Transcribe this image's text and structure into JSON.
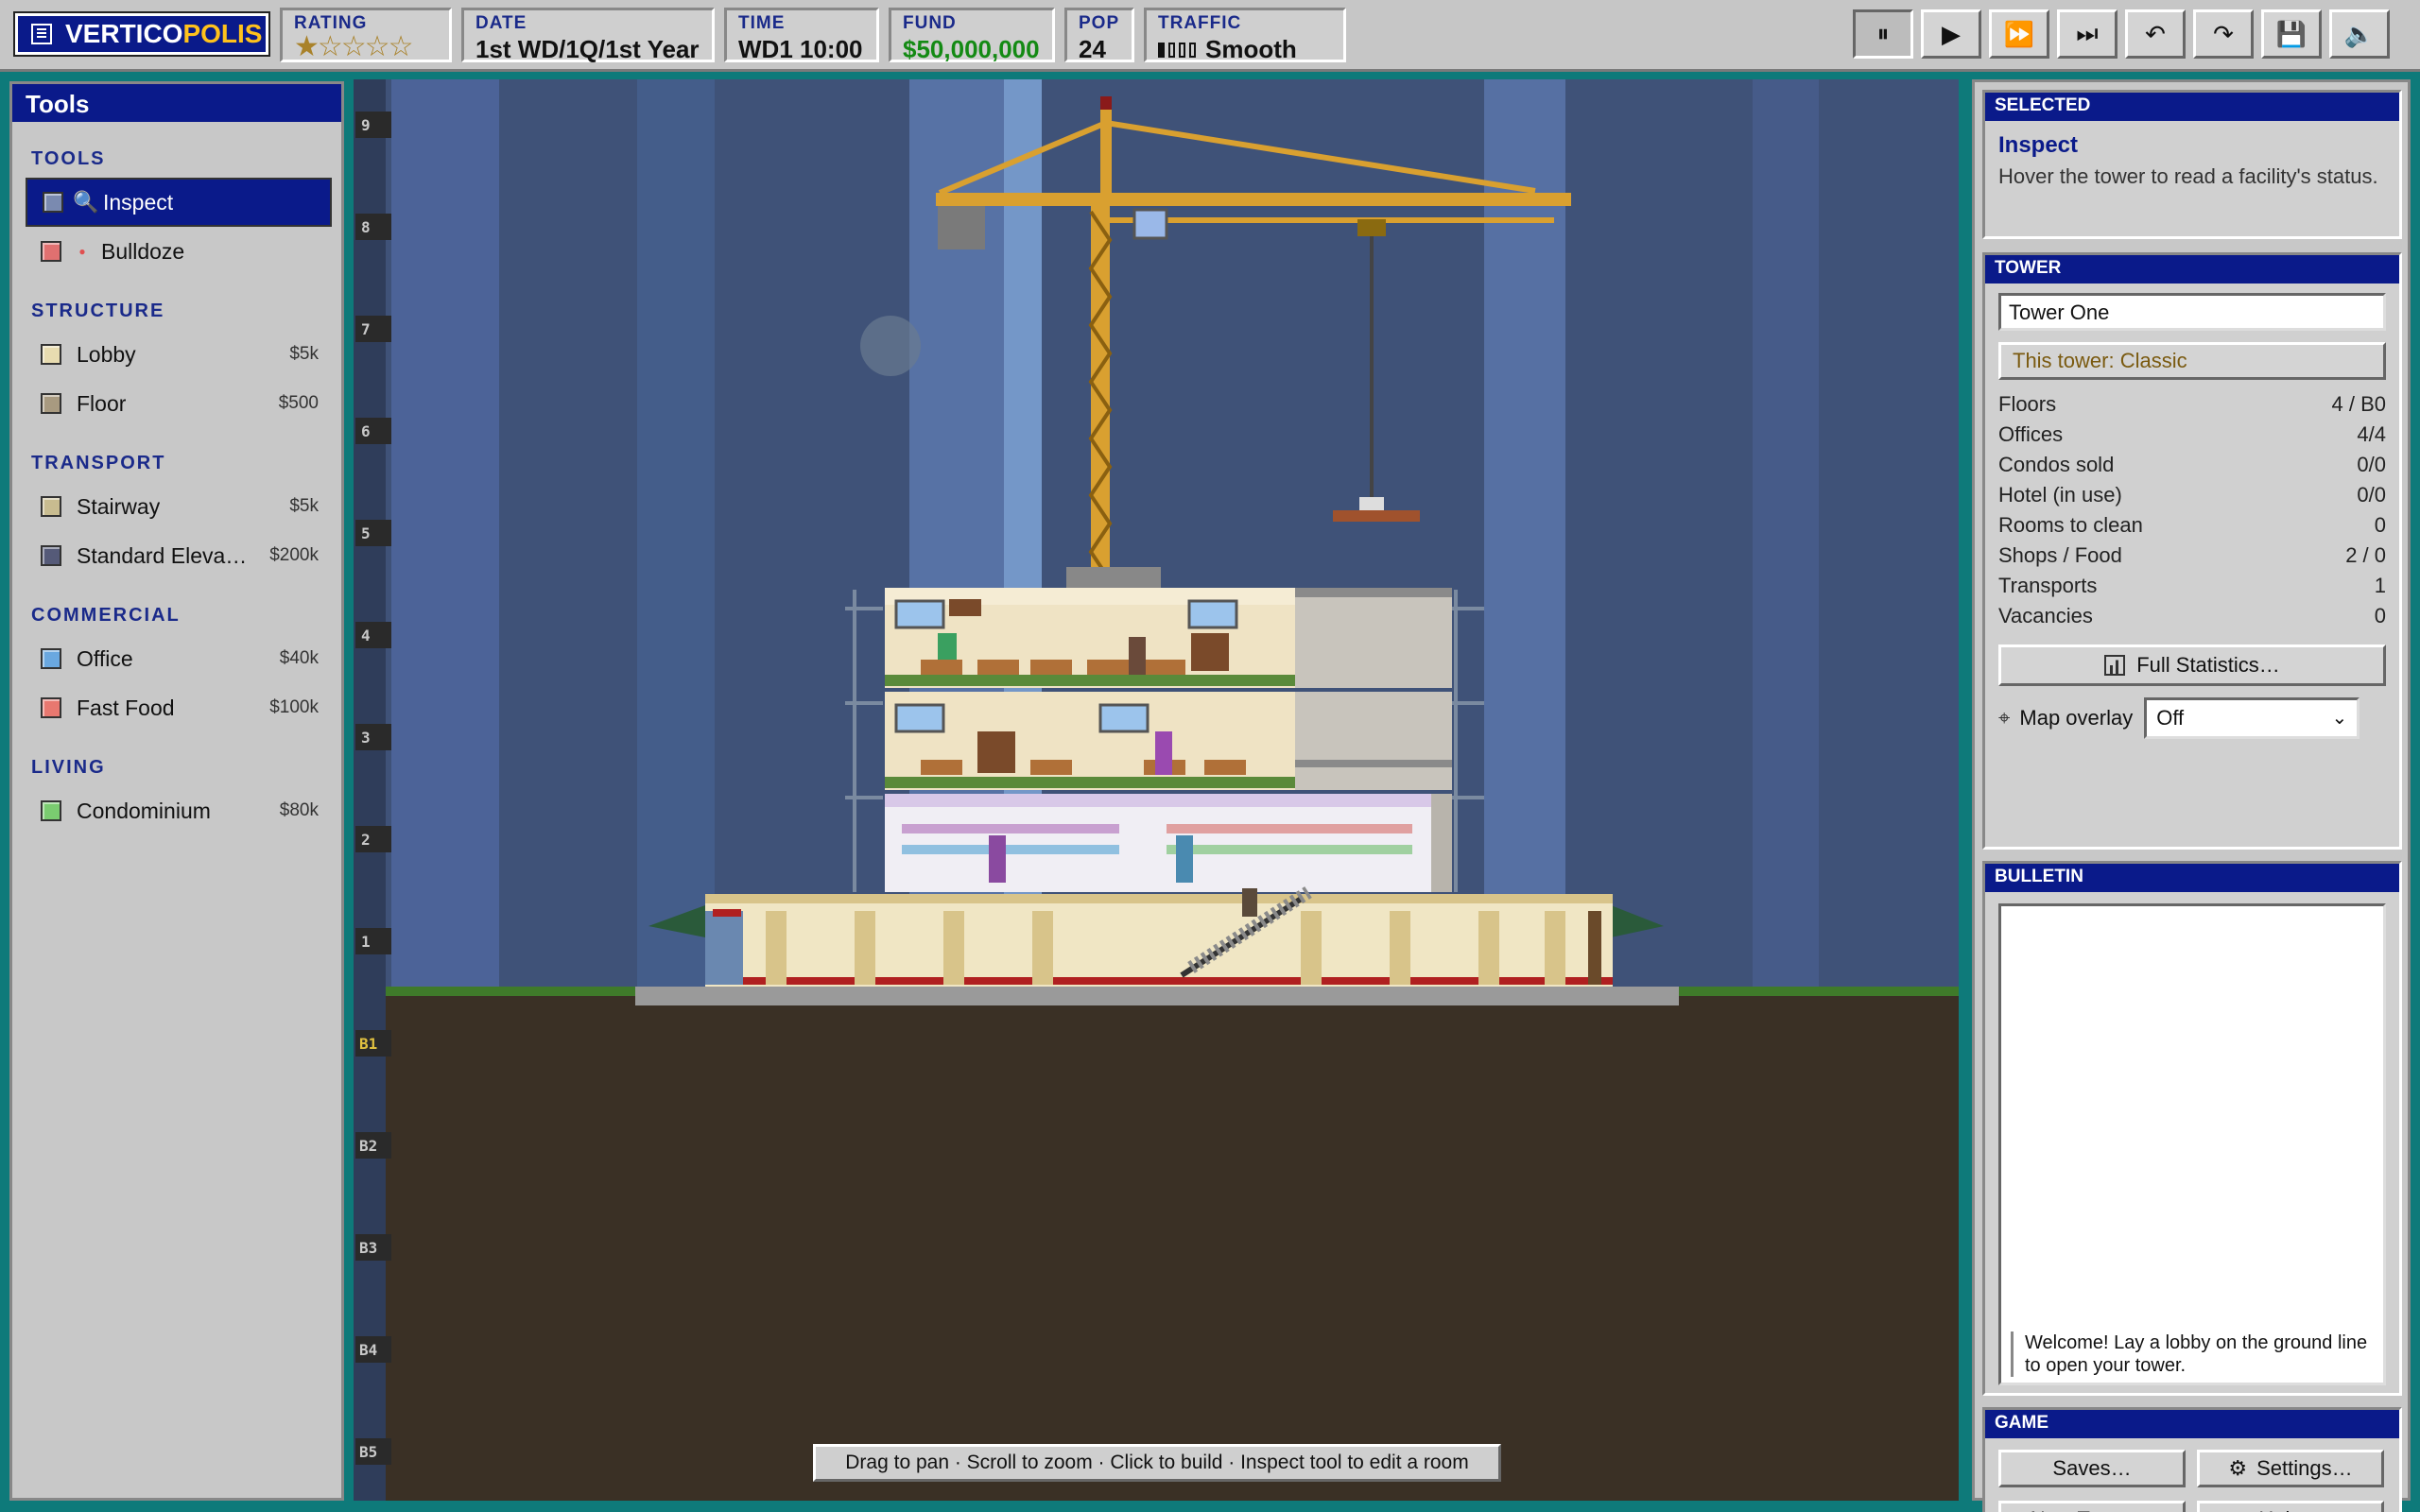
{
  "app": {
    "logo_main": "VERTICO",
    "logo_accent": "POLIS"
  },
  "topbar": {
    "rating_label": "RATING",
    "rating_stars": "★☆☆☆☆",
    "rating_value": 1,
    "rating_max": 5,
    "date_label": "DATE",
    "date_value": "1st WD/1Q/1st Year",
    "time_label": "TIME",
    "time_value": "WD1 10:00",
    "fund_label": "FUND",
    "fund_value": "$50,000,000",
    "pop_label": "POP",
    "pop_value": "24",
    "traffic_label": "TRAFFIC",
    "traffic_value": "Smooth",
    "traffic_level": 1,
    "traffic_max": 4,
    "controls": [
      {
        "name": "pause-icon",
        "glyph": "⏸",
        "active": true
      },
      {
        "name": "play-icon",
        "glyph": "▶"
      },
      {
        "name": "fast-forward-icon",
        "glyph": "⏩"
      },
      {
        "name": "fastest-forward-icon",
        "glyph": "⏭"
      },
      {
        "name": "undo-icon",
        "glyph": "↶"
      },
      {
        "name": "redo-icon",
        "glyph": "↷"
      },
      {
        "name": "save-icon",
        "glyph": "💾"
      },
      {
        "name": "sound-icon",
        "glyph": "🔈"
      }
    ]
  },
  "tools": {
    "title": "Tools",
    "sections": [
      {
        "heading": "TOOLS",
        "items": [
          {
            "label": "Inspect",
            "icon": "search-icon",
            "glyph": "🔍",
            "cost": "",
            "color": "#7a8ab0",
            "selected": true
          },
          {
            "label": "Bulldoze",
            "icon": "bulldoze-icon",
            "glyph": "●",
            "cost": "",
            "color": "#e07070"
          }
        ]
      },
      {
        "heading": "STRUCTURE",
        "items": [
          {
            "label": "Lobby",
            "cost": "$5k",
            "color": "#e8dcb0"
          },
          {
            "label": "Floor",
            "cost": "$500",
            "color": "#a89a80"
          }
        ]
      },
      {
        "heading": "TRANSPORT",
        "items": [
          {
            "label": "Stairway",
            "cost": "$5k",
            "color": "#c8bc90"
          },
          {
            "label": "Standard Eleva…",
            "cost": "$200k",
            "color": "#555a78"
          }
        ]
      },
      {
        "heading": "COMMERCIAL",
        "items": [
          {
            "label": "Office",
            "cost": "$40k",
            "color": "#6aa8e0"
          },
          {
            "label": "Fast Food",
            "cost": "$100k",
            "color": "#e87870"
          }
        ]
      },
      {
        "heading": "LIVING",
        "items": [
          {
            "label": "Condominium",
            "cost": "$80k",
            "color": "#7acc70"
          }
        ]
      }
    ]
  },
  "view": {
    "floor_labels": [
      "9",
      "8",
      "7",
      "6",
      "5",
      "4",
      "3",
      "2",
      "1",
      "B1",
      "B2",
      "B3",
      "B4",
      "B5"
    ],
    "hint": "Drag to pan · Scroll to zoom · Click to build · Inspect tool to edit a room"
  },
  "selected": {
    "heading": "SELECTED",
    "name": "Inspect",
    "desc": "Hover the tower to read a facility's status."
  },
  "tower": {
    "heading": "TOWER",
    "name_value": "Tower One",
    "style_button": "This tower: Classic",
    "stats": [
      {
        "label": "Floors",
        "value": "4 / B0"
      },
      {
        "label": "Offices",
        "value": "4/4"
      },
      {
        "label": "Condos sold",
        "value": "0/0"
      },
      {
        "label": "Hotel (in use)",
        "value": "0/0"
      },
      {
        "label": "Rooms to clean",
        "value": "0"
      },
      {
        "label": "Shops / Food",
        "value": "2 / 0"
      },
      {
        "label": "Transports",
        "value": "1"
      },
      {
        "label": "Vacancies",
        "value": "0"
      }
    ],
    "full_stats_button": "Full Statistics…",
    "overlay_label": "Map overlay",
    "overlay_value": "Off"
  },
  "bulletin": {
    "heading": "BULLETIN",
    "message": "Welcome! Lay a lobby on the ground line to open your tower."
  },
  "game": {
    "heading": "GAME",
    "saves": "Saves…",
    "settings": "Settings…",
    "new_tower": "New Tower…",
    "help": "Help…"
  }
}
